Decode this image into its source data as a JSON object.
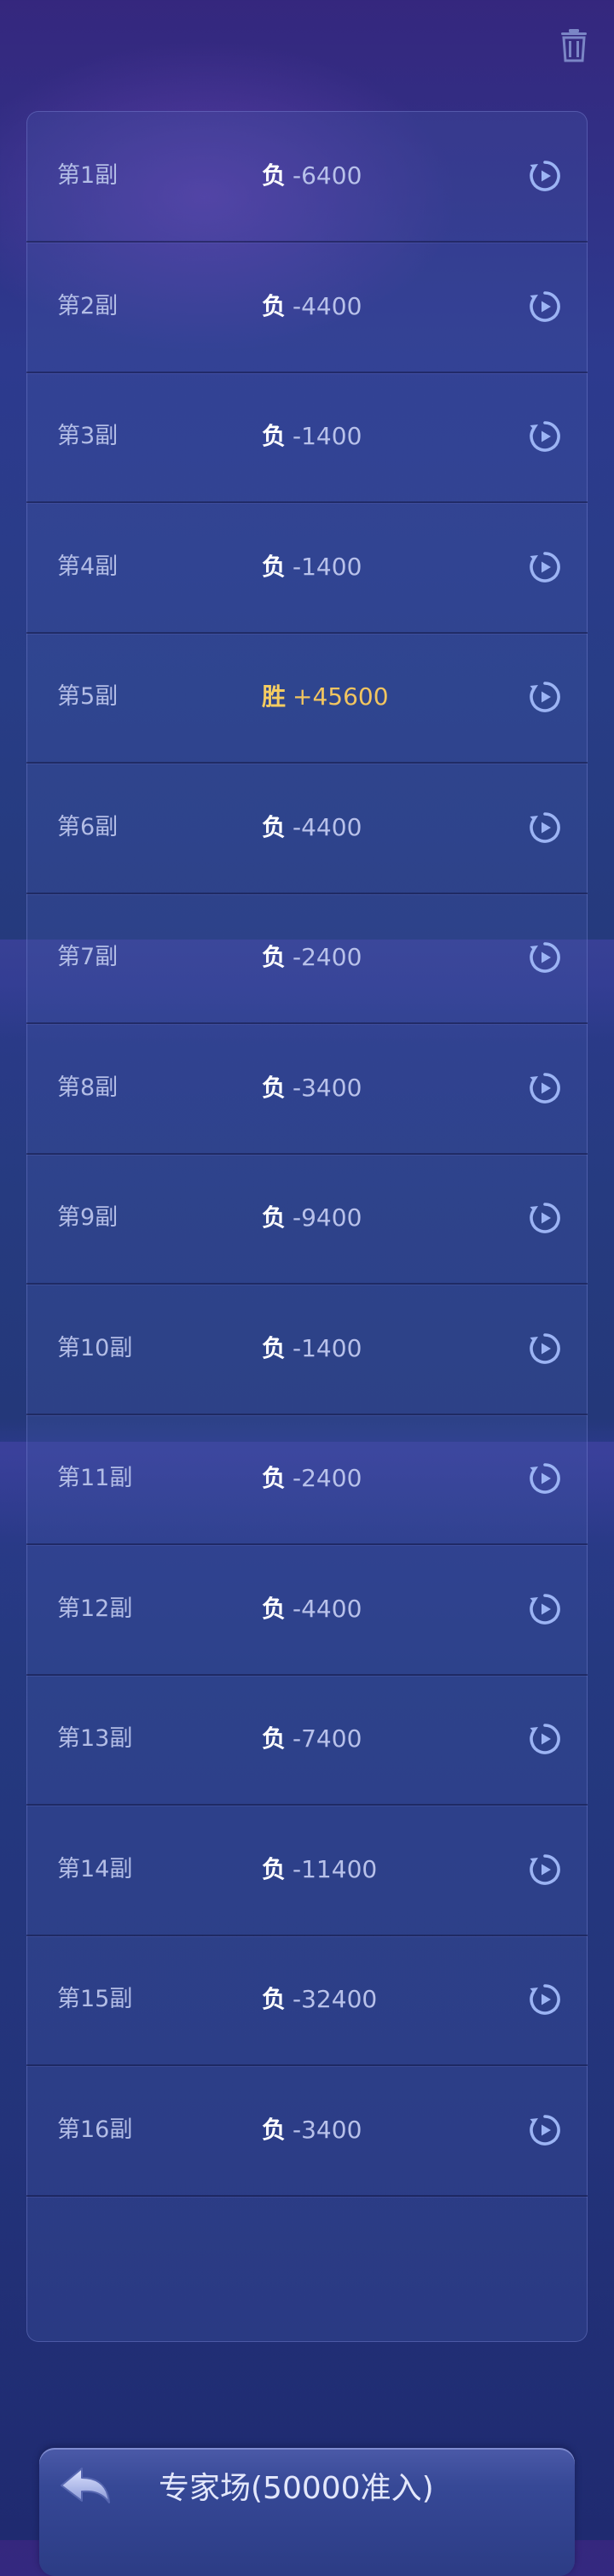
{
  "header": {
    "delete_icon": "trash-icon"
  },
  "records": [
    {
      "index": "第1副",
      "result": "负",
      "score": "-6400",
      "win": false
    },
    {
      "index": "第2副",
      "result": "负",
      "score": "-4400",
      "win": false
    },
    {
      "index": "第3副",
      "result": "负",
      "score": "-1400",
      "win": false
    },
    {
      "index": "第4副",
      "result": "负",
      "score": "-1400",
      "win": false
    },
    {
      "index": "第5副",
      "result": "胜",
      "score": "+45600",
      "win": true
    },
    {
      "index": "第6副",
      "result": "负",
      "score": "-4400",
      "win": false
    },
    {
      "index": "第7副",
      "result": "负",
      "score": "-2400",
      "win": false
    },
    {
      "index": "第8副",
      "result": "负",
      "score": "-3400",
      "win": false
    },
    {
      "index": "第9副",
      "result": "负",
      "score": "-9400",
      "win": false
    },
    {
      "index": "第10副",
      "result": "负",
      "score": "-1400",
      "win": false
    },
    {
      "index": "第11副",
      "result": "负",
      "score": "-2400",
      "win": false
    },
    {
      "index": "第12副",
      "result": "负",
      "score": "-4400",
      "win": false
    },
    {
      "index": "第13副",
      "result": "负",
      "score": "-7400",
      "win": false
    },
    {
      "index": "第14副",
      "result": "负",
      "score": "-11400",
      "win": false
    },
    {
      "index": "第15副",
      "result": "负",
      "score": "-32400",
      "win": false
    },
    {
      "index": "第16副",
      "result": "负",
      "score": "-3400",
      "win": false
    }
  ],
  "replay_icon": "replay-icon",
  "footer": {
    "back_icon": "back-arrow-icon",
    "room_title": "专家场(50000准入)"
  },
  "colors": {
    "win": "#f6cd61",
    "loss_tag": "#ffffff",
    "text": "#b8c1ea",
    "icon": "#9cb4f4"
  }
}
